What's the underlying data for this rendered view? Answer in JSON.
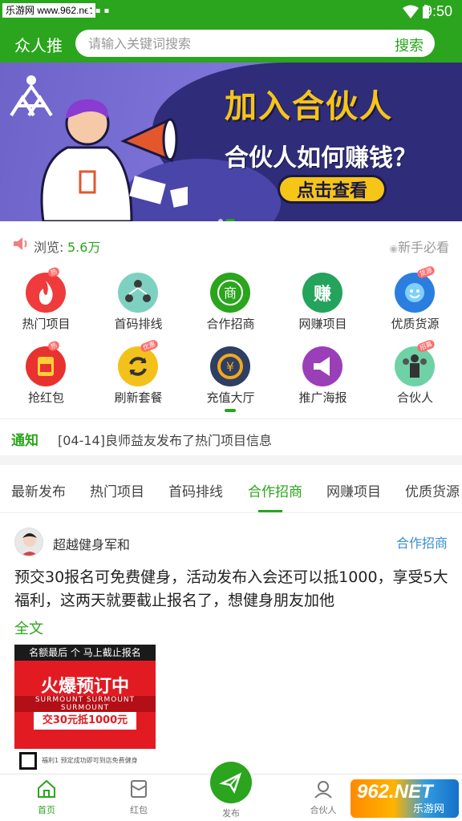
{
  "status_bar": {
    "watermark": "乐游网 www.962.net",
    "time": "9:50"
  },
  "header": {
    "app_title": "众人推",
    "search_placeholder": "请输入关键词搜索",
    "search_button": "搜索"
  },
  "banner": {
    "title": "加入合伙人",
    "subtitle": "合伙人如何赚钱？",
    "button": "点击查看",
    "slide_count": 2,
    "active_slide": 2
  },
  "stats": {
    "views_label": "浏览:",
    "views_count": "5.6万",
    "guide_link": "新手必看"
  },
  "grid": {
    "items": [
      {
        "label": "热门项目",
        "icon": "fire-icon",
        "color": "#ef3b3b",
        "badge": "热"
      },
      {
        "label": "首码排线",
        "icon": "people-tree-icon",
        "color": "#7ed1c0",
        "badge": ""
      },
      {
        "label": "合作招商",
        "icon": "merchant-icon",
        "color": "#2aa51d",
        "badge": ""
      },
      {
        "label": "网赚项目",
        "icon": "earn-icon",
        "color": "#23a35b",
        "badge": ""
      },
      {
        "label": "优质货源",
        "icon": "smile-icon",
        "color": "#2b7ede",
        "badge": "货源"
      },
      {
        "label": "抢红包",
        "icon": "red-packet-icon",
        "color": "#e8322f",
        "badge": "热"
      },
      {
        "label": "刷新套餐",
        "icon": "refresh-icon",
        "color": "#f3c21a",
        "badge": "优惠"
      },
      {
        "label": "充值大厅",
        "icon": "recharge-icon",
        "color": "#2e3f63",
        "badge": ""
      },
      {
        "label": "推广海报",
        "icon": "megaphone-icon",
        "color": "#9a3fb8",
        "badge": ""
      },
      {
        "label": "合伙人",
        "icon": "partner-icon",
        "color": "#6fd1a6",
        "badge": "招募"
      }
    ]
  },
  "notice": {
    "label": "通知",
    "text": "[04-14]良师益友发布了热门项目信息"
  },
  "tabs": [
    {
      "label": "最新发布"
    },
    {
      "label": "热门项目"
    },
    {
      "label": "首码排线"
    },
    {
      "label": "合作招商",
      "active": true
    },
    {
      "label": "网赚项目"
    },
    {
      "label": "优质货源"
    }
  ],
  "post": {
    "author": "超越健身军和",
    "category": "合作招商",
    "body": "预交30报名可免费健身，活动发布入会还可以抵1000，享受5大福利，这两天就要截止报名了，想健身朋友加他",
    "full_text_link": "全文",
    "image": {
      "top_text": "名额最后 个 马上截止报名",
      "headline": "火爆预订中",
      "brand": "SURMOUNT  SURMOUNT  SURMOUNT",
      "price": "交30元抵1000元",
      "note": "福利1 预定成功即可到店免费健身"
    }
  },
  "bottom_nav": {
    "items": [
      {
        "label": "首页",
        "icon": "home-icon",
        "active": true
      },
      {
        "label": "红包",
        "icon": "red-packet-icon"
      },
      {
        "label": "发布",
        "icon": "send-icon"
      },
      {
        "label": "合伙人",
        "icon": "partner-icon"
      }
    ]
  },
  "watermark_bottom": {
    "brand": "962.NET",
    "sub": "乐游网"
  },
  "colors": {
    "primary": "#2aa51d",
    "link_blue": "#3a8fd1",
    "banner_purple": "#6e63c9",
    "banner_yellow": "#f5c518"
  }
}
